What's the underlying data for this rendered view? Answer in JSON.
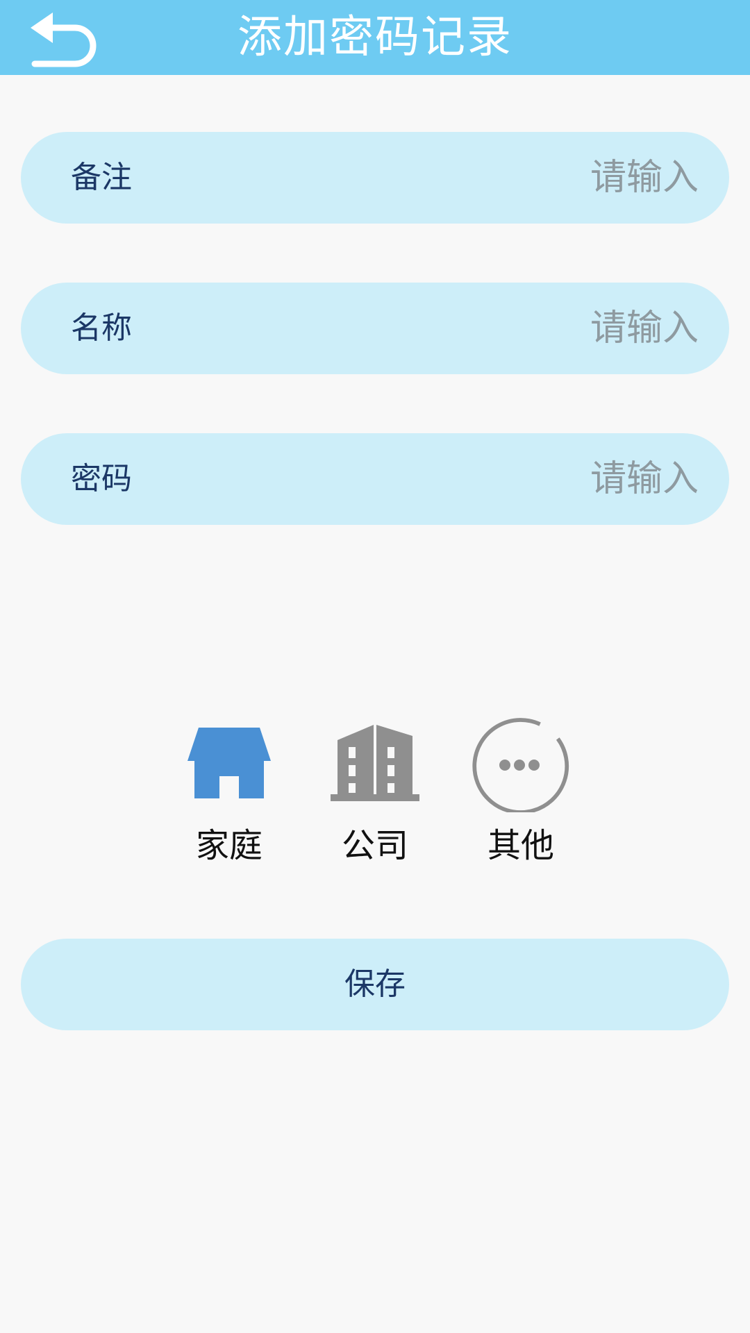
{
  "header": {
    "title": "添加密码记录",
    "back_icon": "back-arrow-icon",
    "background": "#6ecbf2"
  },
  "form": {
    "fields": [
      {
        "label": "备注",
        "placeholder": "请输入",
        "value": ""
      },
      {
        "label": "名称",
        "placeholder": "请输入",
        "value": ""
      },
      {
        "label": "密码",
        "placeholder": "请输入",
        "value": ""
      }
    ]
  },
  "categories": [
    {
      "label": "家庭",
      "icon": "house-icon",
      "color": "#4a90d4",
      "selected": true
    },
    {
      "label": "公司",
      "icon": "building-icon",
      "color": "#8f8f8f",
      "selected": false
    },
    {
      "label": "其他",
      "icon": "more-icon",
      "color": "#8f8f8f",
      "selected": false
    }
  ],
  "save_label": "保存",
  "colors": {
    "field_background": "#cdeef9",
    "label_text": "#1b3766",
    "placeholder_text": "#8e9aa0",
    "page_background": "#f8f8f8"
  }
}
